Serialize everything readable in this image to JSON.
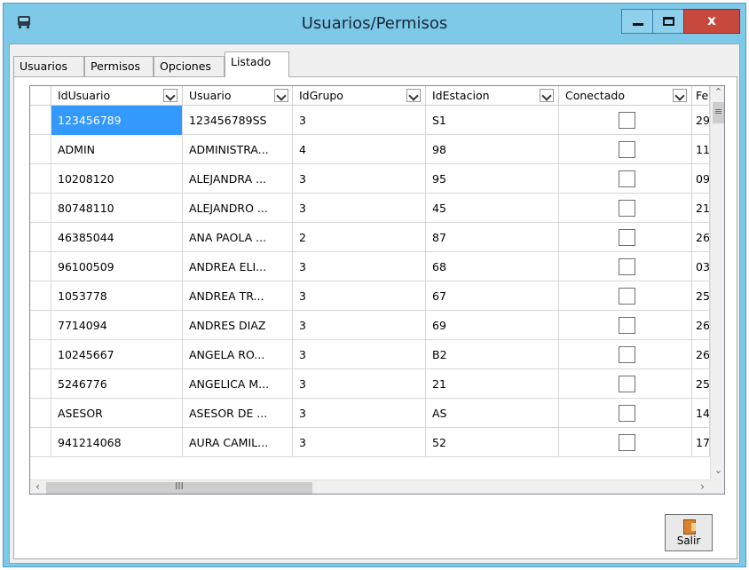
{
  "window": {
    "title": "Usuarios/Permisos",
    "icon": "bus-icon"
  },
  "tabs": [
    {
      "label": "Usuarios",
      "active": false
    },
    {
      "label": "Permisos",
      "active": false
    },
    {
      "label": "Opciones",
      "active": false
    },
    {
      "label": "Listado",
      "active": true
    }
  ],
  "grid": {
    "columns": [
      "IdUsuario",
      "Usuario",
      "IdGrupo",
      "IdEstacion",
      "Conectado",
      "Fe"
    ],
    "rows": [
      {
        "idusuario": "123456789",
        "usuario": "123456789SS",
        "idgrupo": "3",
        "idestacion": "S1",
        "conectado": false,
        "fe": "29",
        "selected": true
      },
      {
        "idusuario": "ADMIN",
        "usuario": "ADMINISTRA...",
        "idgrupo": "4",
        "idestacion": "98",
        "conectado": false,
        "fe": "11"
      },
      {
        "idusuario": "10208120",
        "usuario": "ALEJANDRA ...",
        "idgrupo": "3",
        "idestacion": "95",
        "conectado": false,
        "fe": "09"
      },
      {
        "idusuario": "80748110",
        "usuario": "ALEJANDRO ...",
        "idgrupo": "3",
        "idestacion": "45",
        "conectado": false,
        "fe": "21"
      },
      {
        "idusuario": "46385044",
        "usuario": "ANA PAOLA ...",
        "idgrupo": "2",
        "idestacion": "87",
        "conectado": false,
        "fe": "26"
      },
      {
        "idusuario": "96100509",
        "usuario": "ANDREA ELI...",
        "idgrupo": "3",
        "idestacion": "68",
        "conectado": false,
        "fe": "03"
      },
      {
        "idusuario": "1053778",
        "usuario": "ANDREA TR...",
        "idgrupo": "3",
        "idestacion": "67",
        "conectado": false,
        "fe": "25"
      },
      {
        "idusuario": "7714094",
        "usuario": "ANDRES DIAZ",
        "idgrupo": "3",
        "idestacion": "69",
        "conectado": false,
        "fe": "26"
      },
      {
        "idusuario": "10245667",
        "usuario": "ANGELA RO...",
        "idgrupo": "3",
        "idestacion": "B2",
        "conectado": false,
        "fe": "26"
      },
      {
        "idusuario": "5246776",
        "usuario": "ANGELICA M...",
        "idgrupo": "3",
        "idestacion": "21",
        "conectado": false,
        "fe": "25"
      },
      {
        "idusuario": "ASESOR",
        "usuario": "ASESOR DE ...",
        "idgrupo": "3",
        "idestacion": "AS",
        "conectado": false,
        "fe": "14"
      },
      {
        "idusuario": "941214068",
        "usuario": "AURA CAMIL...",
        "idgrupo": "3",
        "idestacion": "52",
        "conectado": false,
        "fe": "17"
      }
    ]
  },
  "footer": {
    "salir_label": "Salir"
  },
  "colors": {
    "titlebar": "#7ec8e8",
    "selection": "#3399ff",
    "close_button": "#c7483c"
  }
}
